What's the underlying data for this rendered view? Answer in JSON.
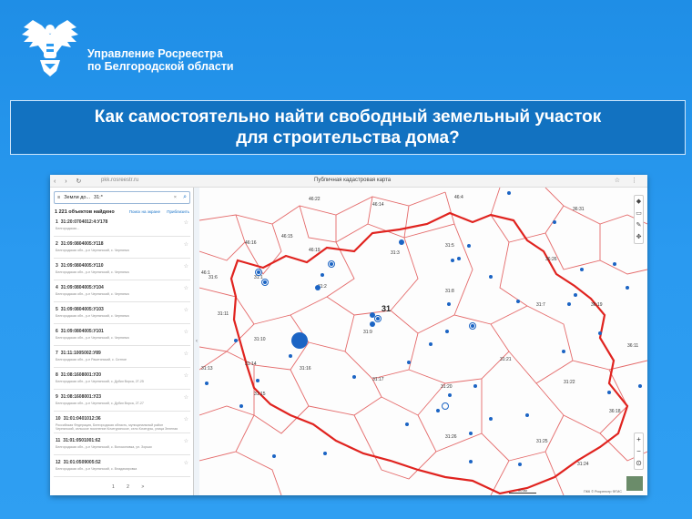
{
  "org": {
    "line1": "Управление Росреестра",
    "line2": "по Белгородской области"
  },
  "title": {
    "line1": "Как самостоятельно найти свободный земельный участок",
    "line2": "для строительства дома?"
  },
  "browser": {
    "url": "pkk.rosreestr.ru",
    "page_title": "Публичная кадастровая карта"
  },
  "search": {
    "tag": "Земли до...",
    "query": "31:*"
  },
  "results": {
    "count": "1 221 объектов найдено",
    "link1": "Поиск на экране",
    "link2": "Приблизить",
    "items": [
      {
        "num": "1",
        "cn": "31:20:0704012:4:У178",
        "addr": "Белгородская..."
      },
      {
        "num": "2",
        "cn": "31:09:0804005:У118",
        "addr": "Белгородская обл., р-н Чернянский, с. Чернянка"
      },
      {
        "num": "3",
        "cn": "31:09:0804005:У110",
        "addr": "Белгородская обл., р-н Чернянский, с. Чернянка"
      },
      {
        "num": "4",
        "cn": "31:09:0804005:У104",
        "addr": "Белгородская обл., р-н Чернянский, с. Чернянка"
      },
      {
        "num": "5",
        "cn": "31:09:0804005:У103",
        "addr": "Белгородская обл., р-н Чернянский, с. Чернянка"
      },
      {
        "num": "6",
        "cn": "31:09:0804005:У101",
        "addr": "Белгородская обл., р-н Чернянский, с. Чернянка"
      },
      {
        "num": "7",
        "cn": "31:11:1005002:У89",
        "addr": "Белгородская обл., р-н Ракитянский, с. Ситное"
      },
      {
        "num": "8",
        "cn": "31:08:1608001:У20",
        "addr": "Белгородская обл., р-н Чернянский, с. Дубки Ворса, 2Г-25"
      },
      {
        "num": "9",
        "cn": "31:08:1608001:У23",
        "addr": "Белгородская обл., р-н Чернянский, с. Дубки Ворса, 2Г-27"
      },
      {
        "num": "10",
        "cn": "31:01:0401012:36",
        "addr": "Российская Федерация, Белгородская область, муниципальный район Чернянский, сельское поселение Кочегуринское, село Кочегуры, улица Зеленая"
      },
      {
        "num": "11",
        "cn": "31:01:0501001:62",
        "addr": "Белгородская обл., р-н Чернянский, с. Волоконовка, ул. Зорьки"
      },
      {
        "num": "12",
        "cn": "31:01:0509005:52",
        "addr": "Белгородская обл., р-н Чернянский, с. Владимировка"
      }
    ]
  },
  "pager": {
    "pages": [
      "1",
      "2",
      ">"
    ]
  },
  "map": {
    "region_label": "31",
    "district_labels": [
      "46:4",
      "46:22",
      "46:14",
      "46:15",
      "46:16",
      "46:19",
      "31:3",
      "31:5",
      "31:1",
      "31:2",
      "31:6",
      "31:8",
      "31:7",
      "31:11",
      "31:9",
      "31:10",
      "31:14",
      "31:16",
      "31:15",
      "31:17",
      "31:21",
      "31:22",
      "31:20",
      "31:26",
      "31:25",
      "31:24",
      "36:31",
      "36:26",
      "36:19",
      "36:11",
      "36:18",
      "31:13",
      "46:1"
    ],
    "zoom_in": "+",
    "zoom_out": "−",
    "attribution": "ПКК © Росреестр ФГИС",
    "scale": "20 км"
  },
  "colors": {
    "region_border": "#e0231f",
    "district_border": "#e46a6a",
    "point": "#1b64c4"
  }
}
